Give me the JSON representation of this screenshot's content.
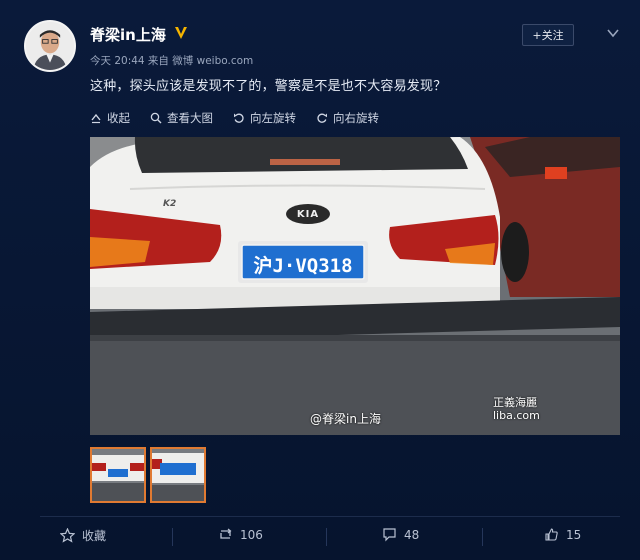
{
  "post": {
    "username": "脊梁in上海",
    "verified_mark": "V",
    "meta": "今天 20:44 来自 微博 weibo.com",
    "follow_label": "+关注",
    "text": "这种，探头应该是发现不了的，警察是不是也不大容易发现？"
  },
  "media_toolbar": {
    "collapse": "收起",
    "view_large": "查看大图",
    "rotate_left": "向左旋转",
    "rotate_right": "向右旋转"
  },
  "photo": {
    "plate_text": "沪J·VQ318",
    "car_model_badge": "K2",
    "brand_logo": "KIA",
    "watermark_user": "@脊梁in上海",
    "watermark_site_line1": "正義海麗",
    "watermark_site_line2": "liba.com"
  },
  "actions": {
    "favorite": "收藏",
    "repost_count": "106",
    "comment_count": "48",
    "like_count": "15"
  },
  "icons": [
    "more-chevron-icon",
    "collapse-icon",
    "zoom-icon",
    "rotate-left-icon",
    "rotate-right-icon",
    "star-icon",
    "repost-icon",
    "comment-icon",
    "thumbs-up-icon"
  ],
  "colors": {
    "background": "#071633",
    "thumb_border": "#e07a32",
    "plate_blue": "#1f6fd0"
  }
}
